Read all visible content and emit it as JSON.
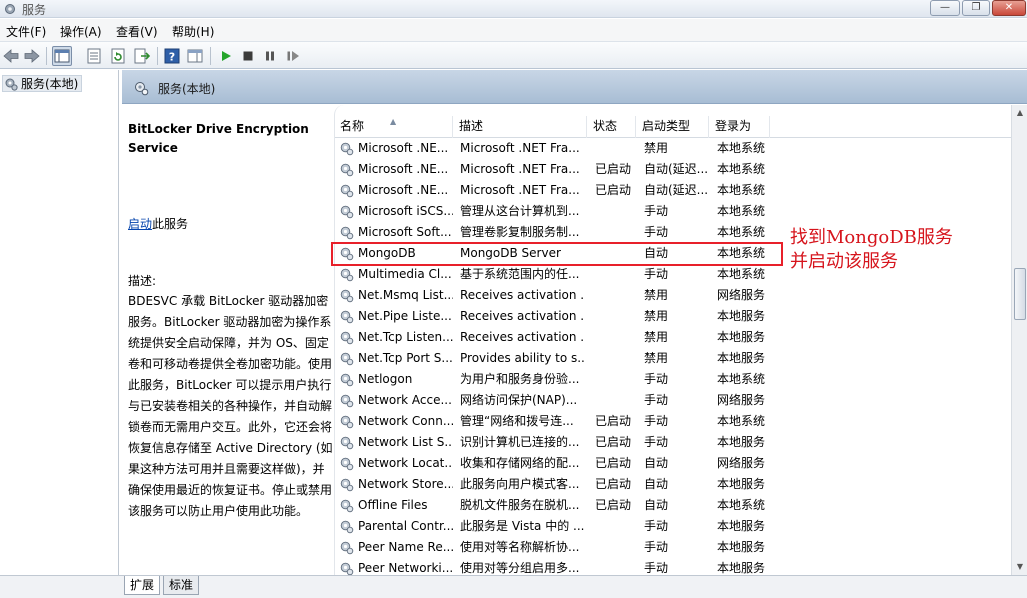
{
  "window": {
    "title": "服务",
    "minimize_glyph": "—",
    "maximize_glyph": "❐",
    "close_glyph": "✕"
  },
  "menu": [
    "文件(F)",
    "操作(A)",
    "查看(V)",
    "帮助(H)"
  ],
  "tree": {
    "root_label": "服务(本地)"
  },
  "pane_header": {
    "title": "服务(本地)"
  },
  "details": {
    "service_title": "BitLocker Drive Encryption Service",
    "action_link": "启动",
    "action_suffix": "此服务",
    "desc_label": "描述:",
    "desc_text": "BDESVC 承载 BitLocker 驱动器加密服务。BitLocker 驱动器加密为操作系统提供安全启动保障，并为 OS、固定卷和可移动卷提供全卷加密功能。使用此服务，BitLocker 可以提示用户执行与已安装卷相关的各种操作，并自动解锁卷而无需用户交互。此外，它还会将恢复信息存储至 Active Directory (如果这种方法可用并且需要这样做)，并确保使用最近的恢复证书。停止或禁用该服务可以防止用户使用此功能。"
  },
  "columns": {
    "name": "名称",
    "description": "描述",
    "status": "状态",
    "startup": "启动类型",
    "logon": "登录为"
  },
  "services": [
    {
      "name": "Microsoft .NE...",
      "desc": "Microsoft .NET Fra...",
      "status": "",
      "startup": "禁用",
      "logon": "本地系统"
    },
    {
      "name": "Microsoft .NE...",
      "desc": "Microsoft .NET Fra...",
      "status": "已启动",
      "startup": "自动(延迟...",
      "logon": "本地系统"
    },
    {
      "name": "Microsoft .NE...",
      "desc": "Microsoft .NET Fra...",
      "status": "已启动",
      "startup": "自动(延迟...",
      "logon": "本地系统"
    },
    {
      "name": "Microsoft iSCS...",
      "desc": "管理从这台计算机到...",
      "status": "",
      "startup": "手动",
      "logon": "本地系统"
    },
    {
      "name": "Microsoft Soft...",
      "desc": "管理卷影复制服务制...",
      "status": "",
      "startup": "手动",
      "logon": "本地系统"
    },
    {
      "name": "MongoDB",
      "desc": "MongoDB Server",
      "status": "",
      "startup": "自动",
      "logon": "本地系统"
    },
    {
      "name": "Multimedia Cl...",
      "desc": "基于系统范围内的任...",
      "status": "",
      "startup": "手动",
      "logon": "本地系统"
    },
    {
      "name": "Net.Msmq List...",
      "desc": "Receives activation ...",
      "status": "",
      "startup": "禁用",
      "logon": "网络服务"
    },
    {
      "name": "Net.Pipe Liste...",
      "desc": "Receives activation ...",
      "status": "",
      "startup": "禁用",
      "logon": "本地服务"
    },
    {
      "name": "Net.Tcp Listen...",
      "desc": "Receives activation ...",
      "status": "",
      "startup": "禁用",
      "logon": "本地服务"
    },
    {
      "name": "Net.Tcp Port S...",
      "desc": "Provides ability to s...",
      "status": "",
      "startup": "禁用",
      "logon": "本地服务"
    },
    {
      "name": "Netlogon",
      "desc": "为用户和服务身份验...",
      "status": "",
      "startup": "手动",
      "logon": "本地系统"
    },
    {
      "name": "Network Acce...",
      "desc": "网络访问保护(NAP)...",
      "status": "",
      "startup": "手动",
      "logon": "网络服务"
    },
    {
      "name": "Network Conn...",
      "desc": "管理“网络和拨号连...",
      "status": "已启动",
      "startup": "手动",
      "logon": "本地系统"
    },
    {
      "name": "Network List S...",
      "desc": "识别计算机已连接的...",
      "status": "已启动",
      "startup": "手动",
      "logon": "本地服务"
    },
    {
      "name": "Network Locat...",
      "desc": "收集和存储网络的配...",
      "status": "已启动",
      "startup": "自动",
      "logon": "网络服务"
    },
    {
      "name": "Network Store...",
      "desc": "此服务向用户模式客...",
      "status": "已启动",
      "startup": "自动",
      "logon": "本地服务"
    },
    {
      "name": "Offline Files",
      "desc": "脱机文件服务在脱机...",
      "status": "已启动",
      "startup": "自动",
      "logon": "本地系统"
    },
    {
      "name": "Parental Contr...",
      "desc": "此服务是 Vista 中的 ...",
      "status": "",
      "startup": "手动",
      "logon": "本地服务"
    },
    {
      "name": "Peer Name Re...",
      "desc": "使用对等名称解析协...",
      "status": "",
      "startup": "手动",
      "logon": "本地服务"
    },
    {
      "name": "Peer Networki...",
      "desc": "使用对等分组启用多...",
      "status": "",
      "startup": "手动",
      "logon": "本地服务"
    }
  ],
  "annotation": {
    "line1": "找到MongoDB服务",
    "line2": "并启动该服务",
    "color": "#d6141c"
  },
  "bottom_tabs": [
    "扩展",
    "标准"
  ],
  "icons": {
    "app": "gear-icon",
    "back": "back-arrow-icon",
    "forward": "forward-arrow-icon",
    "console_tree": "console-tree-icon",
    "properties": "properties-icon",
    "refresh": "refresh-icon",
    "export": "export-list-icon",
    "help": "help-icon",
    "show_hide": "show-hide-pane-icon",
    "start": "play-icon",
    "stop": "stop-icon",
    "pause": "pause-icon",
    "resume": "resume-icon",
    "service": "service-gear-icon"
  }
}
